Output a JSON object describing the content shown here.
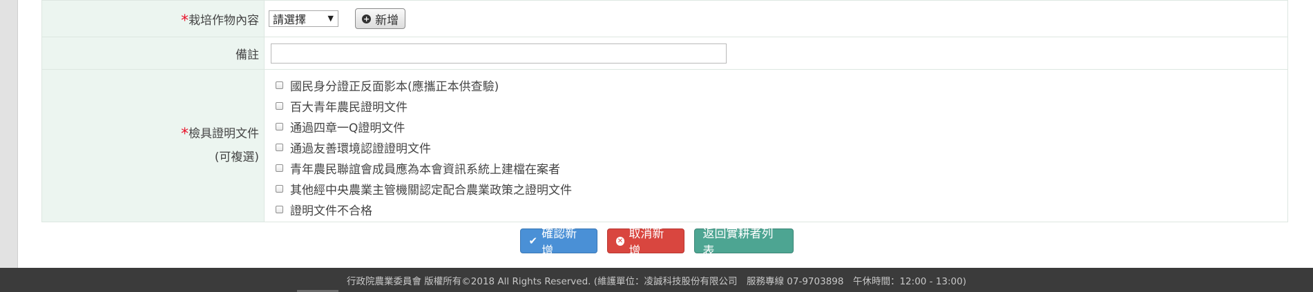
{
  "form": {
    "crop": {
      "label": "栽培作物內容",
      "select_value": "請選擇",
      "add_button": "新增"
    },
    "note": {
      "label": "備註",
      "value": ""
    },
    "documents": {
      "label": "檢具證明文件",
      "sublabel": "(可複選)",
      "items": [
        "國民身分證正反面影本(應攜正本供查驗)",
        "百大青年農民證明文件",
        "通過四章一Q證明文件",
        "通過友善環境認證證明文件",
        "青年農民聯誼會成員應為本會資訊系統上建檔在案者",
        "其他經中央農業主管機關認定配合農業政策之證明文件",
        "證明文件不合格"
      ]
    }
  },
  "actions": {
    "confirm": "確認新增",
    "cancel": "取消新增",
    "back": "返回實耕者列表"
  },
  "footer": {
    "text": "行政院農業委員會 版權所有©2018 All Rights Reserved. (維護單位：凌誠科技股份有限公司　服務專線 07-9703898　午休時間：12:00 - 13:00)"
  },
  "colors": {
    "label_bg": "#ecf5f0",
    "required": "#e8132a",
    "confirm": "#4a90d6",
    "cancel": "#d9463f",
    "back": "#4da592",
    "footer_bg": "#3b3b3b"
  }
}
